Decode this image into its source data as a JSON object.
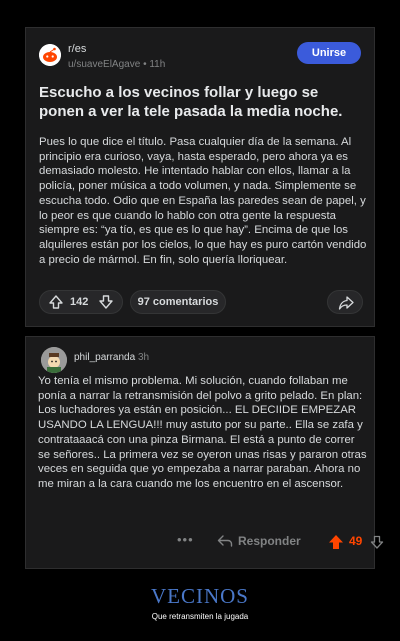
{
  "post": {
    "subreddit": "r/es",
    "author": "u/suaveElAgave",
    "age": "11h",
    "join_label": "Unirse",
    "title": "Escucho a los vecinos follar y luego se ponen a ver la tele pasada la media noche.",
    "body": "Pues lo que dice el título. Pasa cualquier día de la semana. Al principio era curioso, vaya, hasta esperado, pero ahora ya es demasiado molesto. He intentado hablar con ellos, llamar a la policía, poner música a todo volumen, y nada. Simplemente se escucha todo. Odio que en España las paredes sean de papel, y lo peor es que cuando lo hablo con otra gente la respuesta siempre es: “ya tío, es que es lo que hay”. Encima de que los alquileres están por los cielos, lo que hay es puro cartón vendido a precio de mármol. En fin, solo quería lloriquear.",
    "upvotes": "142",
    "comments_label": "97 comentarios"
  },
  "comment": {
    "username": "phil_parranda",
    "age": "3h",
    "body": "Yo tenía el mismo problema. Mi solución, cuando follaban me ponía a narrar la retransmisión del polvo a grito pelado. En plan: Los luchadores ya están en posición... EL DECIIDE EMPEZAR USANDO LA LENGUA!!! muy astuto por su parte.. Ella se zafa y contrataaacá con una pinza Birmana. El está a punto de correr se señores.. La primera vez se oyeron unas risas y pararon otras veces en seguida que yo empezaba a narrar paraban. Ahora no me miran a la cara cuando me los encuentro en el ascensor.",
    "dots": "•••",
    "reply_label": "Responder",
    "score": "49"
  },
  "footer": {
    "title": "VECINOS",
    "subtitle": "Que retransmiten la jugada"
  },
  "colors": {
    "accent": "#3b5bdb",
    "upvote": "#ff4500",
    "footer_title": "#4a78c9"
  }
}
